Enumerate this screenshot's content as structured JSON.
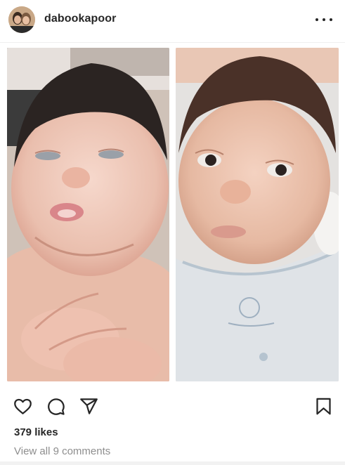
{
  "post": {
    "username": "dabookapoor",
    "likes_text": "379 likes",
    "comments_text": "View all 9 comments"
  },
  "icons": {
    "avatar": "profile-avatar",
    "more": "more-options-icon",
    "like": "heart-icon",
    "comment": "comment-bubble-icon",
    "share": "paper-plane-icon",
    "save": "bookmark-icon"
  },
  "colors": {
    "text": "#262626",
    "muted": "#8e8e8e",
    "background": "#ffffff"
  }
}
